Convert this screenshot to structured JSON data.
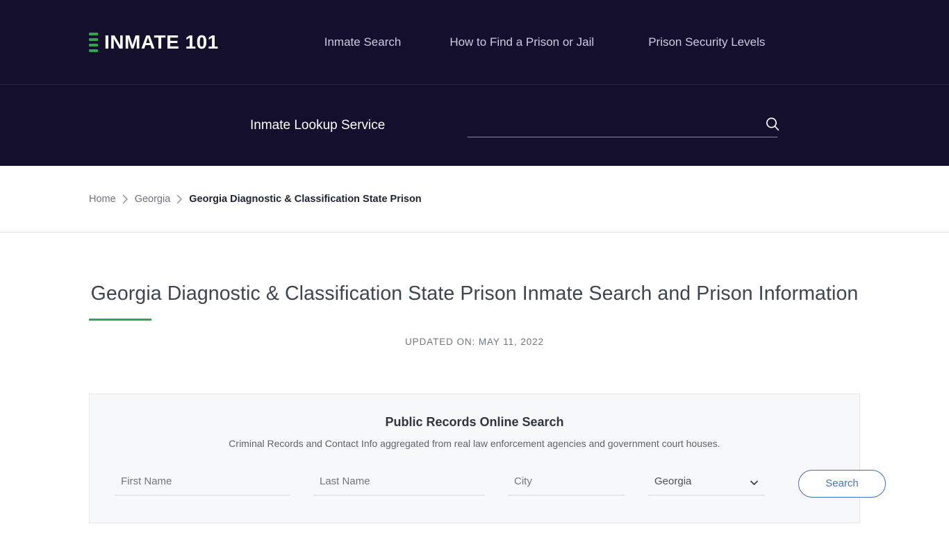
{
  "site": {
    "brand_name": "INMATE 101",
    "brand_mark_bars": 4,
    "accent_green": "#2ea84a",
    "header_bg": "#150f2e",
    "link_blue": "#4a76bd"
  },
  "nav": {
    "items": [
      {
        "label": "Inmate Search"
      },
      {
        "label": "How to Find a Prison or Jail"
      },
      {
        "label": "Prison Security Levels"
      }
    ]
  },
  "lookup": {
    "label": "Inmate Lookup Service",
    "search_value": "",
    "search_placeholder": "",
    "search_icon": "search-icon"
  },
  "breadcrumb": {
    "items": [
      {
        "label": "Home",
        "current": false
      },
      {
        "label": "Georgia",
        "current": false
      },
      {
        "label": "Georgia Diagnostic & Classification State Prison",
        "current": true
      }
    ],
    "separator_icon": "chevron-right-icon"
  },
  "article": {
    "title": "Georgia Diagnostic & Classification State Prison Inmate Search and Prison Information",
    "updated": "UPDATED ON: MAY 11, 2022"
  },
  "records": {
    "title": "Public Records Online Search",
    "subtitle": "Criminal Records and Contact Info aggregated from real law enforcement agencies and government court houses.",
    "fields": {
      "first_name": {
        "placeholder": "First Name",
        "value": ""
      },
      "last_name": {
        "placeholder": "Last Name",
        "value": ""
      },
      "city": {
        "placeholder": "City",
        "value": ""
      },
      "state": {
        "selected": "Georgia",
        "options": [
          "Georgia"
        ],
        "icon": "chevron-down-icon"
      }
    },
    "search_button": "Search"
  }
}
